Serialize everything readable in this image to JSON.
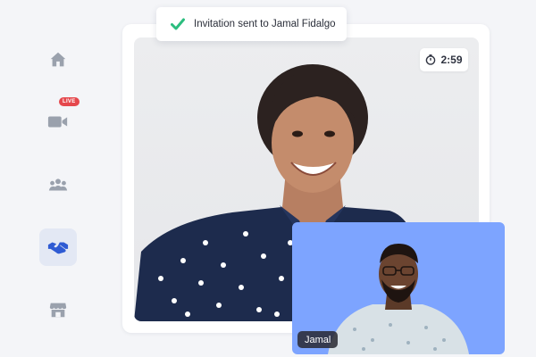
{
  "app": {
    "accent_color": "#2f5bd3",
    "live_color": "#e5484d"
  },
  "sidebar": {
    "items": [
      {
        "name": "home",
        "icon": "home-icon",
        "active": false
      },
      {
        "name": "live-video",
        "icon": "video-camera-icon",
        "badge": "LIVE",
        "active": false
      },
      {
        "name": "groups",
        "icon": "people-group-icon",
        "active": false
      },
      {
        "name": "deals",
        "icon": "handshake-icon",
        "active": true
      },
      {
        "name": "store",
        "icon": "storefront-icon",
        "active": false
      }
    ]
  },
  "toast": {
    "icon": "checkmark-icon",
    "icon_color": "#2bbd7e",
    "message": "Invitation sent to Jamal Fidalgo"
  },
  "call": {
    "timer_icon": "stopwatch-icon",
    "timer": "2:59",
    "pip_background": "#7da4ff",
    "pip_name": "Jamal"
  }
}
